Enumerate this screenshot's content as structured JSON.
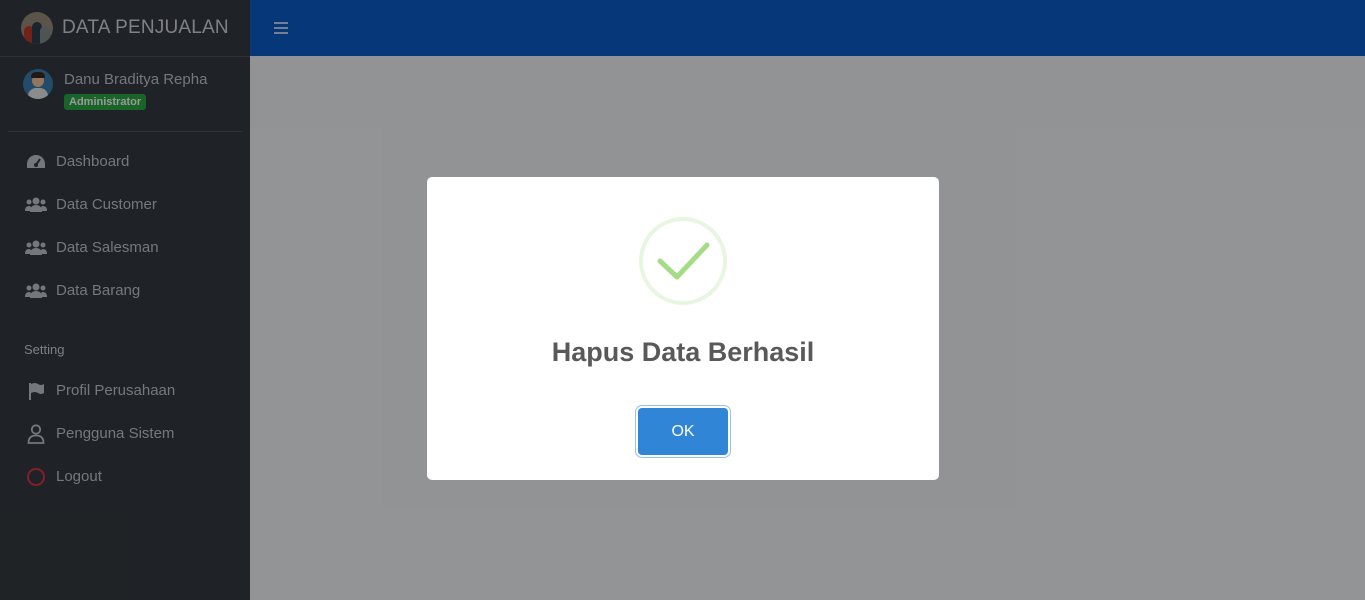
{
  "brand": {
    "title": "DATA PENJUALAN"
  },
  "user": {
    "name": "Danu Braditya Repha",
    "role": "Administrator"
  },
  "sidebar": {
    "items": [
      {
        "label": "Dashboard",
        "icon": "tachometer-icon"
      },
      {
        "label": "Data Customer",
        "icon": "users-icon"
      },
      {
        "label": "Data Salesman",
        "icon": "users-icon"
      },
      {
        "label": "Data Barang",
        "icon": "users-icon"
      }
    ],
    "setting_header": "Setting",
    "setting_items": [
      {
        "label": "Profil Perusahaan",
        "icon": "flag-icon"
      },
      {
        "label": "Pengguna Sistem",
        "icon": "user-icon"
      },
      {
        "label": "Logout",
        "icon": "circle-icon"
      }
    ]
  },
  "navbar": {
    "menu_icon": "hamburger-icon",
    "color": "#0b5cc9"
  },
  "modal": {
    "title": "Hapus Data Berhasil",
    "ok_label": "OK",
    "icon": "success-check-icon",
    "accent": "#3085d6",
    "success_color": "#a5dc86"
  }
}
